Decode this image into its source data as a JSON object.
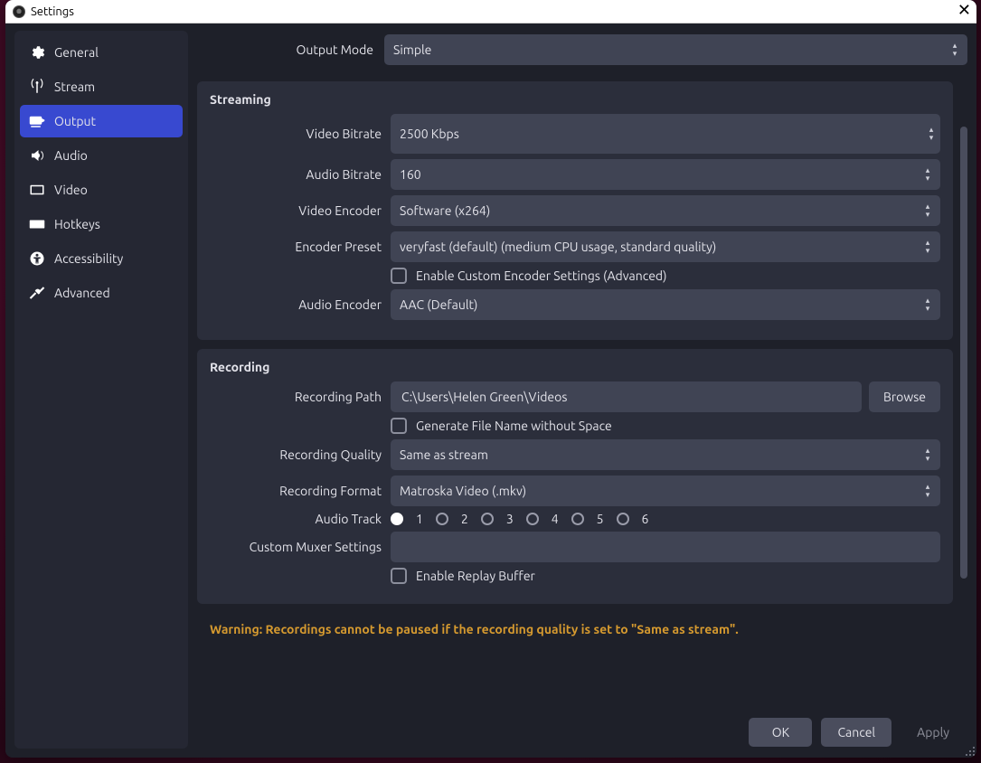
{
  "window": {
    "title": "Settings",
    "close_glyph": "✕"
  },
  "sidebar": {
    "items": [
      {
        "label": "General",
        "name": "sidebar-item-general",
        "icon": "gear-icon"
      },
      {
        "label": "Stream",
        "name": "sidebar-item-stream",
        "icon": "antenna-icon"
      },
      {
        "label": "Output",
        "name": "sidebar-item-output",
        "icon": "output-icon",
        "selected": true
      },
      {
        "label": "Audio",
        "name": "sidebar-item-audio",
        "icon": "audio-icon"
      },
      {
        "label": "Video",
        "name": "sidebar-item-video",
        "icon": "video-icon"
      },
      {
        "label": "Hotkeys",
        "name": "sidebar-item-hotkeys",
        "icon": "keyboard-icon"
      },
      {
        "label": "Accessibility",
        "name": "sidebar-item-accessibility",
        "icon": "accessibility-icon"
      },
      {
        "label": "Advanced",
        "name": "sidebar-item-advanced",
        "icon": "tools-icon"
      }
    ]
  },
  "output_mode": {
    "label": "Output Mode",
    "value": "Simple"
  },
  "streaming": {
    "title": "Streaming",
    "video_bitrate": {
      "label": "Video Bitrate",
      "value": "2500 Kbps"
    },
    "audio_bitrate": {
      "label": "Audio Bitrate",
      "value": "160"
    },
    "video_encoder": {
      "label": "Video Encoder",
      "value": "Software (x264)"
    },
    "encoder_preset": {
      "label": "Encoder Preset",
      "value": "veryfast (default) (medium CPU usage, standard quality)"
    },
    "enable_custom": {
      "label": "Enable Custom Encoder Settings (Advanced)",
      "checked": false
    },
    "audio_encoder": {
      "label": "Audio Encoder",
      "value": "AAC (Default)"
    }
  },
  "recording": {
    "title": "Recording",
    "path": {
      "label": "Recording Path",
      "value": "C:\\Users\\Helen Green\\Videos",
      "browse": "Browse"
    },
    "no_space": {
      "label": "Generate File Name without Space",
      "checked": false
    },
    "quality": {
      "label": "Recording Quality",
      "value": "Same as stream"
    },
    "format": {
      "label": "Recording Format",
      "value": "Matroska Video (.mkv)"
    },
    "audio_track": {
      "label": "Audio Track",
      "tracks": [
        "1",
        "2",
        "3",
        "4",
        "5",
        "6"
      ],
      "selected": 0
    },
    "muxer": {
      "label": "Custom Muxer Settings",
      "value": ""
    },
    "replay_buffer": {
      "label": "Enable Replay Buffer",
      "checked": false
    }
  },
  "warning": "Warning: Recordings cannot be paused if the recording quality is set to \"Same as stream\".",
  "footer": {
    "ok": "OK",
    "cancel": "Cancel",
    "apply": "Apply"
  }
}
